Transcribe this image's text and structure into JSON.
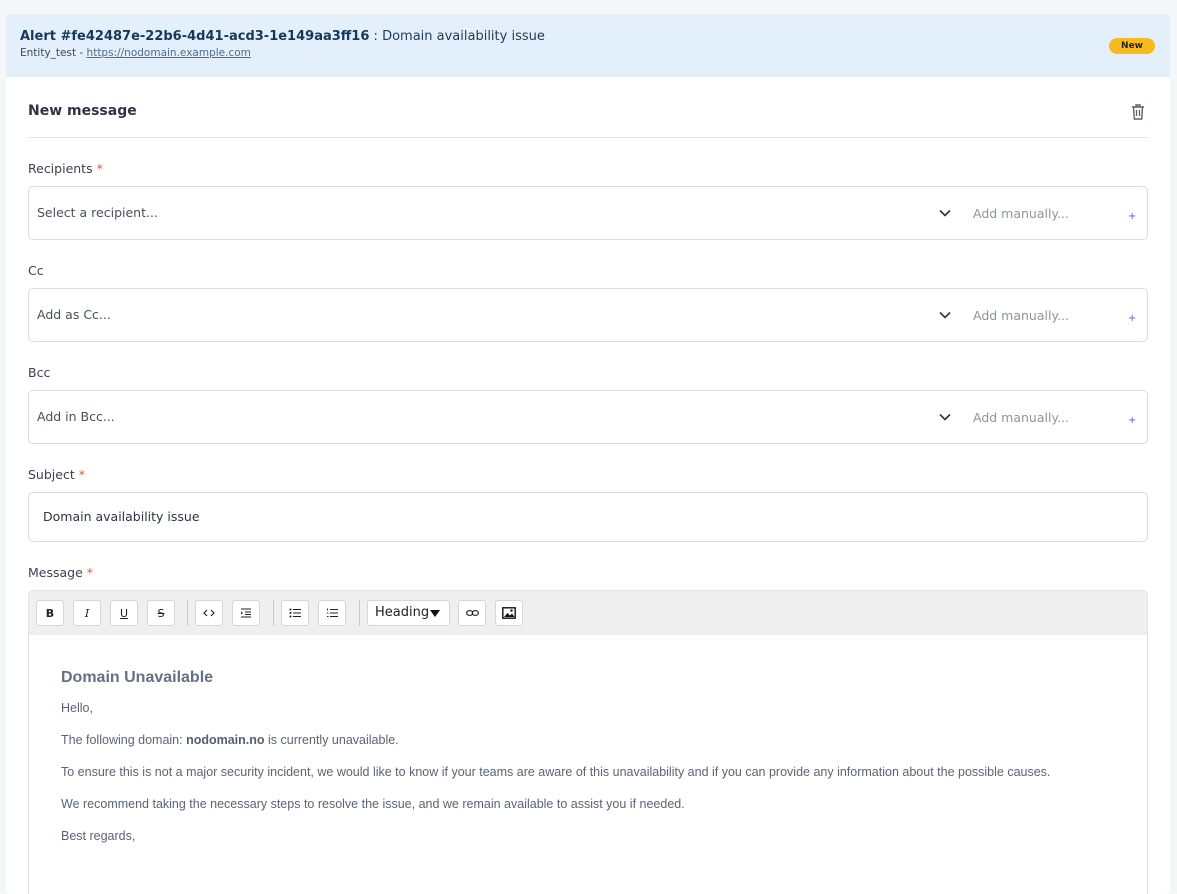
{
  "alert": {
    "id_label": "Alert #fe42487e-22b6-4d41-acd3-1e149aa3ff16",
    "separator": " : ",
    "title": "Domain availability issue",
    "entity": "Entity_test",
    "entity_separator": " - ",
    "url": "https://nodomain.example.com",
    "status_badge": "New",
    "badge_color": "#f8bb1f"
  },
  "composer": {
    "title": "New message",
    "delete_icon": "trash-icon",
    "required_mark": "*",
    "recipients": {
      "label": "Recipients",
      "placeholder": "Select a recipient...",
      "manual_placeholder": "Add manually...",
      "add_symbol": "+"
    },
    "cc": {
      "label": "Cc",
      "placeholder": "Add as Cc...",
      "manual_placeholder": "Add manually...",
      "add_symbol": "+"
    },
    "bcc": {
      "label": "Bcc",
      "placeholder": "Add in Bcc...",
      "manual_placeholder": "Add manually...",
      "add_symbol": "+"
    },
    "subject": {
      "label": "Subject",
      "value": "Domain availability issue"
    },
    "message": {
      "label": "Message",
      "toolbar": {
        "bold": "B",
        "italic": "I",
        "underline": "U",
        "strike": "S",
        "heading_select": "Heading",
        "icons": [
          "bold-icon",
          "italic-icon",
          "underline-icon",
          "strikethrough-icon",
          "code-icon",
          "indent-icon",
          "bullet-list-icon",
          "numbered-list-icon",
          "link-icon",
          "image-icon"
        ]
      },
      "body": {
        "heading": "Domain Unavailable",
        "greeting": "Hello,",
        "line1_prefix": "The following domain: ",
        "line1_domain": "nodomain.no",
        "line1_suffix": " is currently unavailable.",
        "line2": "To ensure this is not a major security incident, we would like to know if your teams are aware of this unavailability and if you can provide any information about the possible causes.",
        "line3": "We recommend taking the necessary steps to resolve the issue, and we remain available to assist you if needed.",
        "closing": "Best regards,"
      }
    }
  },
  "colors": {
    "header_bg": "#e3effa",
    "required": "#e4572e",
    "accent": "#4d5fd1"
  }
}
